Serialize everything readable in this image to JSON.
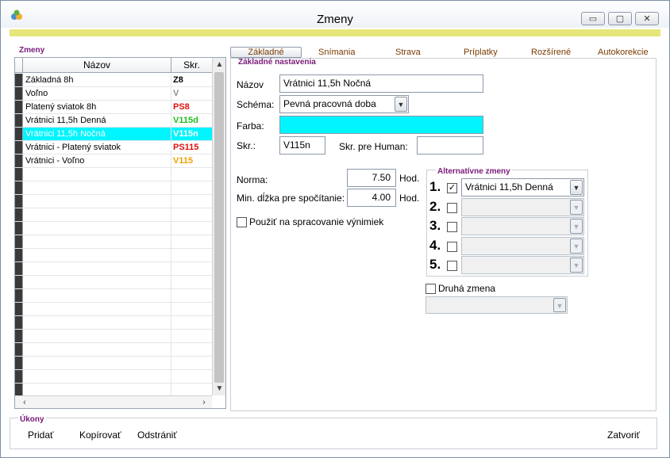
{
  "window": {
    "title": "Zmeny"
  },
  "list": {
    "group_label": "Zmeny",
    "columns": {
      "name": "Názov",
      "code": "Skr."
    },
    "rows": [
      {
        "name": "Základná 8h",
        "code": "Z8",
        "code_color": "#000000"
      },
      {
        "name": "Voľno",
        "code": "V",
        "code_color": "#909090"
      },
      {
        "name": "Platený sviatok 8h",
        "code": "PS8",
        "code_color": "#e01010"
      },
      {
        "name": "Vrátnici 11,5h Denná",
        "code": "V115d",
        "code_color": "#20c020"
      },
      {
        "name": "Vrátnici 11,5h Nočná",
        "code": "V115n",
        "code_color": "#ffffff"
      },
      {
        "name": "Vrátnici - Platený sviatok",
        "code": "PS115",
        "code_color": "#e01010"
      },
      {
        "name": "Vrátnici - Voľno",
        "code": "V115",
        "code_color": "#f0a000"
      }
    ],
    "selected_row_color": "#00f5ff"
  },
  "tabs": [
    {
      "label": "Základné",
      "active": true
    },
    {
      "label": "Snímania"
    },
    {
      "label": "Strava"
    },
    {
      "label": "Príplatky"
    },
    {
      "label": "Rozšírené"
    },
    {
      "label": "Autokorekcie"
    }
  ],
  "basic": {
    "group_label": "Základné nastavenia",
    "name_label": "Názov",
    "name_value": "Vrátnici 11,5h Nočná",
    "schema_label": "Schéma:",
    "schema_value": "Pevná pracovná doba",
    "color_label": "Farba:",
    "color_value": "#00f5ff",
    "code_label": "Skr.:",
    "code_value": "V115n",
    "human_label": "Skr. pre Human:",
    "human_value": "",
    "norm_label": "Norma:",
    "norm_value": "7.50",
    "norm_unit": "Hod.",
    "min_label": "Min. dĺžka pre spočítanie:",
    "min_value": "4.00",
    "min_unit": "Hod.",
    "exception_label": "Použiť na spracovanie výnimiek"
  },
  "alternatives": {
    "group_label": "Alternatívne zmeny",
    "items": [
      {
        "num": "1.",
        "checked": true,
        "value": "Vrátnici 11,5h Denná"
      },
      {
        "num": "2.",
        "checked": false,
        "value": ""
      },
      {
        "num": "3.",
        "checked": false,
        "value": ""
      },
      {
        "num": "4.",
        "checked": false,
        "value": ""
      },
      {
        "num": "5.",
        "checked": false,
        "value": ""
      }
    ]
  },
  "second_shift": {
    "label": "Druhá zmena",
    "value": ""
  },
  "actions": {
    "group_label": "Úkony",
    "add": "Pridať",
    "copy": "Kopírovať",
    "remove": "Odstrániť",
    "close": "Zatvoriť"
  }
}
